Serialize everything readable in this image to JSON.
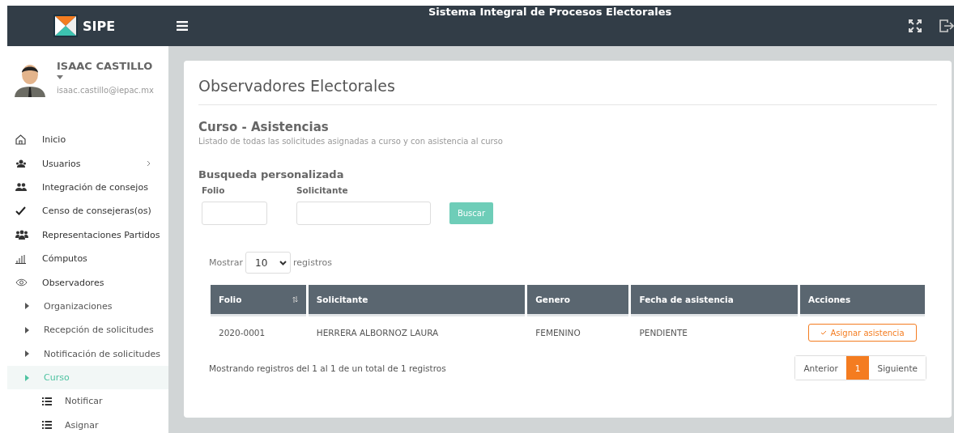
{
  "header": {
    "logo": "SIPE",
    "title": "Sistema Integral de Procesos Electorales"
  },
  "user": {
    "name": "ISAAC CASTILLO",
    "email": "isaac.castillo@iepac.mx"
  },
  "sidebar": {
    "items": [
      {
        "label": "Inicio",
        "kind": "home",
        "selected": false
      },
      {
        "label": "Usuarios",
        "kind": "users",
        "selected": false,
        "expandable": true
      },
      {
        "label": "Integración de consejos",
        "kind": "people",
        "selected": false
      },
      {
        "label": "Censo de consejeras(os)",
        "kind": "check",
        "selected": false
      },
      {
        "label": "Representaciones Partidos",
        "kind": "group",
        "selected": false
      },
      {
        "label": "Cómputos",
        "kind": "bars",
        "selected": false
      },
      {
        "label": "Observadores",
        "kind": "eye",
        "selected": false,
        "children": [
          {
            "label": "Organizaciones",
            "kind": "caret",
            "selected": false
          },
          {
            "label": "Recepción de solicitudes",
            "kind": "caret",
            "selected": false
          },
          {
            "label": "Notificación de solicitudes",
            "kind": "caret",
            "selected": false
          },
          {
            "label": "Curso",
            "kind": "caret",
            "selected": true,
            "children": [
              {
                "label": "Notificar",
                "kind": "list",
                "selected": false
              },
              {
                "label": "Asignar",
                "kind": "list",
                "selected": false
              }
            ]
          }
        ]
      }
    ]
  },
  "page": {
    "title": "Observadores Electorales",
    "section": "Curso - Asistencias",
    "subtitle": "Listado de todas las solicitudes asignadas a curso y con asistencia al curso",
    "search": {
      "title": "Busqueda personalizada",
      "fields": [
        {
          "label": "Folio"
        },
        {
          "label": "Solicitante"
        }
      ],
      "button": "Buscar"
    },
    "length": {
      "before": "Mostrar",
      "value": "10",
      "after": "registros"
    },
    "table": {
      "columns": [
        {
          "label": "Folio",
          "sortable": true
        },
        {
          "label": "Solicitante",
          "sortable": false
        },
        {
          "label": "Genero",
          "sortable": false
        },
        {
          "label": "Fecha de asistencia",
          "sortable": false
        },
        {
          "label": "Acciones",
          "sortable": false
        }
      ],
      "rows": [
        {
          "cells": [
            "2020-0001",
            "HERRERA ALBORNOZ LAURA",
            "FEMENINO",
            "PENDIENTE"
          ],
          "action": "Asignar asistencia"
        }
      ]
    },
    "info": "Mostrando registros del 1 al 1 de un total de 1 registros",
    "pagination": {
      "previous": "Anterior",
      "pages": [
        {
          "label": "1",
          "selected": true
        }
      ],
      "next": "Siguiente"
    }
  }
}
